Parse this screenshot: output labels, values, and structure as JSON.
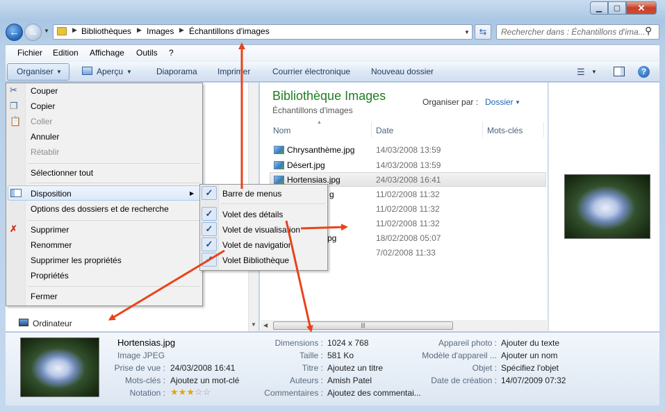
{
  "window": {
    "min": "▁",
    "max": "▢",
    "close": "✕"
  },
  "address": {
    "crumbs": [
      "Bibliothèques",
      "Images",
      "Échantillons d'images"
    ],
    "search_placeholder": "Rechercher dans : Échantillons d'ima..."
  },
  "menubar": [
    "Fichier",
    "Edition",
    "Affichage",
    "Outils",
    "?"
  ],
  "toolbar": {
    "organize": "Organiser",
    "preview": "Aperçu",
    "slideshow": "Diaporama",
    "print": "Imprimer",
    "email": "Courrier électronique",
    "new_folder": "Nouveau dossier"
  },
  "library": {
    "title": "Bibliothèque Images",
    "subtitle": "Échantillons d'images",
    "arrange_label": "Organiser par :",
    "arrange_value": "Dossier"
  },
  "columns": [
    "Nom",
    "Date",
    "Mots-clés"
  ],
  "files": [
    {
      "name": "Chrysanthème.jpg",
      "date": "14/03/2008 13:59"
    },
    {
      "name": "Désert.jpg",
      "date": "14/03/2008 13:59"
    },
    {
      "name": "Hortensias.jpg",
      "date": "24/03/2008 16:41"
    },
    {
      "name": "g",
      "date": "11/02/2008 11:32"
    },
    {
      "name": "",
      "date": "11/02/2008 11:32"
    },
    {
      "name": "",
      "date": "11/02/2008 11:32"
    },
    {
      "name": "pg",
      "date": "18/02/2008 05:07"
    },
    {
      "name": "",
      "date": "7/02/2008 11:33"
    }
  ],
  "menu": {
    "cut": "Couper",
    "copy": "Copier",
    "paste": "Coller",
    "undo": "Annuler",
    "redo": "Rétablir",
    "select_all": "Sélectionner tout",
    "layout": "Disposition",
    "folder_options": "Options des dossiers et de recherche",
    "delete": "Supprimer",
    "rename": "Renommer",
    "remove_props": "Supprimer les propriétés",
    "properties": "Propriétés",
    "close": "Fermer"
  },
  "submenu": {
    "menu_bar": "Barre de menus",
    "details_pane": "Volet des détails",
    "preview_pane": "Volet de visualisation",
    "nav_pane": "Volet de navigation",
    "library_pane": "Volet Bibliothèque"
  },
  "nav": {
    "computer": "Ordinateur"
  },
  "details": {
    "filename": "Hortensias.jpg",
    "type": "Image JPEG",
    "taken_label": "Prise de vue :",
    "taken_value": "24/03/2008 16:41",
    "tags_label": "Mots-clés :",
    "tags_value": "Ajoutez un mot-clé",
    "rating_label": "Notation :",
    "rating": 3,
    "rating_max": 5,
    "dim_label": "Dimensions :",
    "dim_value": "1024 x 768",
    "size_label": "Taille :",
    "size_value": "581 Ko",
    "title_label": "Titre :",
    "title_value": "Ajoutez un titre",
    "authors_label": "Auteurs :",
    "authors_value": "Amish Patel",
    "comments_label": "Commentaires :",
    "comments_value": "Ajoutez des commentai...",
    "camera_label": "Appareil photo :",
    "camera_value": "Ajouter du texte",
    "model_label": "Modèle d'appareil ...",
    "model_value": "Ajouter un nom",
    "subject_label": "Objet :",
    "subject_value": "Spécifiez l'objet",
    "created_label": "Date de création :",
    "created_value": "14/07/2009 07:32"
  },
  "colors": {
    "arrow": "#e8431a",
    "library_title": "#1e7d21",
    "link": "#1e63b4"
  }
}
